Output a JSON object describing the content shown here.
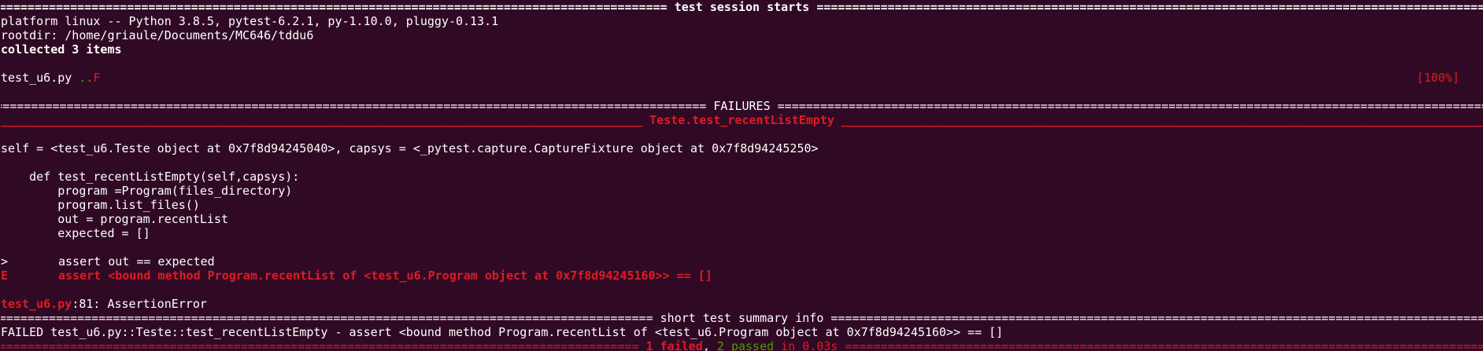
{
  "session_header": {
    "fill_char": "=",
    "title": " test session starts "
  },
  "platform_line": "platform linux -- Python 3.8.5, pytest-6.2.1, py-1.10.0, pluggy-0.13.1",
  "rootdir_line": "rootdir: /home/griaule/Documents/MC646/tddu6",
  "collected_line": "collected 3 items",
  "test_file": {
    "name": "test_u6.py ",
    "passed_marks": "..",
    "failed_mark": "F",
    "progress": "[100%]"
  },
  "failures_header": {
    "fill_char": "=",
    "title": " FAILURES "
  },
  "test_header": {
    "fill_char": "_",
    "title": " Teste.test_recentListEmpty "
  },
  "self_line": "self = <test_u6.Teste object at 0x7f8d94245040>, capsys = <_pytest.capture.CaptureFixture object at 0x7f8d94245250>",
  "code_lines": [
    "    def test_recentListEmpty(self,capsys):",
    "        program =Program(files_directory)",
    "        program.list_files()",
    "        out = program.recentList",
    "        expected = []"
  ],
  "assert_line": {
    "marker": ">",
    "code": "assert out == expected"
  },
  "error_line": {
    "marker": "E",
    "code": "assert <bound method Program.recentList of <test_u6.Program object at 0x7f8d94245160>> == []"
  },
  "location_line": {
    "file": "test_u6.py",
    "rest": ":81: AssertionError"
  },
  "summary_header": {
    "fill_char": "=",
    "title": " short test summary info "
  },
  "failed_summary": "FAILED test_u6.py::Teste::test_recentListEmpty - assert <bound method Program.recentList of <test_u6.Program object at 0x7f8d94245160>> == []",
  "final_line": {
    "fill_char": "=",
    "failed": "1 failed",
    "comma": ", ",
    "passed": "2 passed",
    "time": " in 0.03s"
  },
  "colors": {
    "background": "#300a24",
    "text": "#ffffff",
    "error_red": "#e01b24",
    "pass_green": "#4e9a06"
  }
}
